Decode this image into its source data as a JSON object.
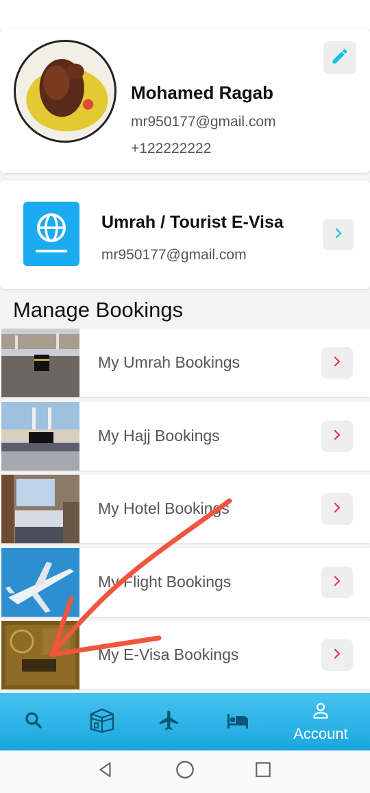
{
  "profile": {
    "name": "Mohamed Ragab",
    "email": "mr950177@gmail.com",
    "phone": "+122222222",
    "avatar_icon": "food-photo-avatar",
    "edit_icon": "pencil-icon"
  },
  "visa_card": {
    "title": "Umrah / Tourist E-Visa",
    "email": "mr950177@gmail.com",
    "icon": "passport-globe-icon"
  },
  "manage_bookings": {
    "title": "Manage Bookings",
    "items": [
      {
        "label": "My Umrah Bookings",
        "thumb": "kaaba-crowd-photo"
      },
      {
        "label": "My Hajj Bookings",
        "thumb": "hajj-mosque-photo"
      },
      {
        "label": "My Hotel Bookings",
        "thumb": "hotel-room-photo"
      },
      {
        "label": "My Flight Bookings",
        "thumb": "airplane-sky-photo"
      },
      {
        "label": "My E-Visa Bookings",
        "thumb": "passport-photo"
      }
    ]
  },
  "bottom_nav": {
    "items": [
      {
        "icon": "search-icon",
        "label": ""
      },
      {
        "icon": "kaaba-icon",
        "label": ""
      },
      {
        "icon": "airplane-icon",
        "label": ""
      },
      {
        "icon": "bed-icon",
        "label": ""
      },
      {
        "icon": "account-icon",
        "label": "Account"
      }
    ],
    "active": "Account"
  },
  "colors": {
    "accent": "#1aabf0",
    "chevron_red": "#e53950",
    "nav_gradient_top": "#45c3ee",
    "annotation_arrow": "#f0553d"
  }
}
